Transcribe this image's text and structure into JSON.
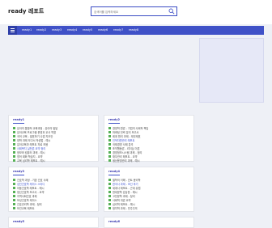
{
  "header": {
    "logo": "ready 레포트",
    "search_placeholder": "검색어를 입력하세요"
  },
  "nav": {
    "items": [
      "ready1",
      "ready2",
      "ready3",
      "ready4",
      "ready5",
      "ready6",
      "ready7",
      "ready8"
    ]
  },
  "cards": [
    {
      "title": "ready1",
      "items": [
        "유아의 통합적 교육과정 - 유아의 발달",
        "유아교육 프로그램 운영과 교사 역할",
        "국어 교육 - 발표하기 수업 지도안",
        "대학 과제 보고서 작성법 - 예시",
        "유아교육과 레포트 자료 모음",
        "사회복지 실천론 요약 정리",
        "정보와 컴퓨터 과제 - 예시",
        "영어 회화 학습지 - 요약",
        "교육 심리학 레포트 - 예시"
      ],
      "highlight": [
        5
      ]
    },
    {
      "title": "ready2",
      "items": [
        "경영학 원론 - 기업의 사회적 책임",
        "마케팅 전략 분석 보고서",
        "회계 원리 과제 - 재무제표",
        "인적자원관리 레포트",
        "국제경영 사례 분석",
        "조직행동론 - 리더십 이론",
        "경영정보시스템 과제 - 정리",
        "재무관리 레포트 - 요약",
        "생산운영관리 과제 - 예시"
      ],
      "highlight": [
        3
      ]
    },
    {
      "title": "ready3",
      "items": [
        "간호학 과정 - 기본 간호 사례",
        "성인간호학 케이스 스터디",
        "아동간호학 레포트 - 예시",
        "정신간호학 보고서 - 요약",
        "지역사회간호 과제",
        "모성간호학 케이스",
        "간호관리학 과제 - 정리",
        "보건교육 레포트"
      ],
      "highlight": [
        1
      ]
    },
    {
      "title": "ready4",
      "items": [
        "철학의 이해 - 칸트 윤리학",
        "한국사 과제 - 조선 후기",
        "세계사 레포트 - 근대 유럽",
        "현대문학 감상문 - 예시",
        "고전문학 과제 - 정리",
        "사회학 개론 요약",
        "심리학 레포트 - 예시",
        "정치학 과제 - 민주주의"
      ],
      "highlight": [
        1
      ]
    },
    {
      "title": "ready5",
      "items": [],
      "highlight": []
    },
    {
      "title": "ready6",
      "items": [],
      "highlight": []
    }
  ],
  "colors": {
    "accent": "#3f51c7",
    "bullet": "#55b055",
    "link_blue": "#3a50d0"
  }
}
